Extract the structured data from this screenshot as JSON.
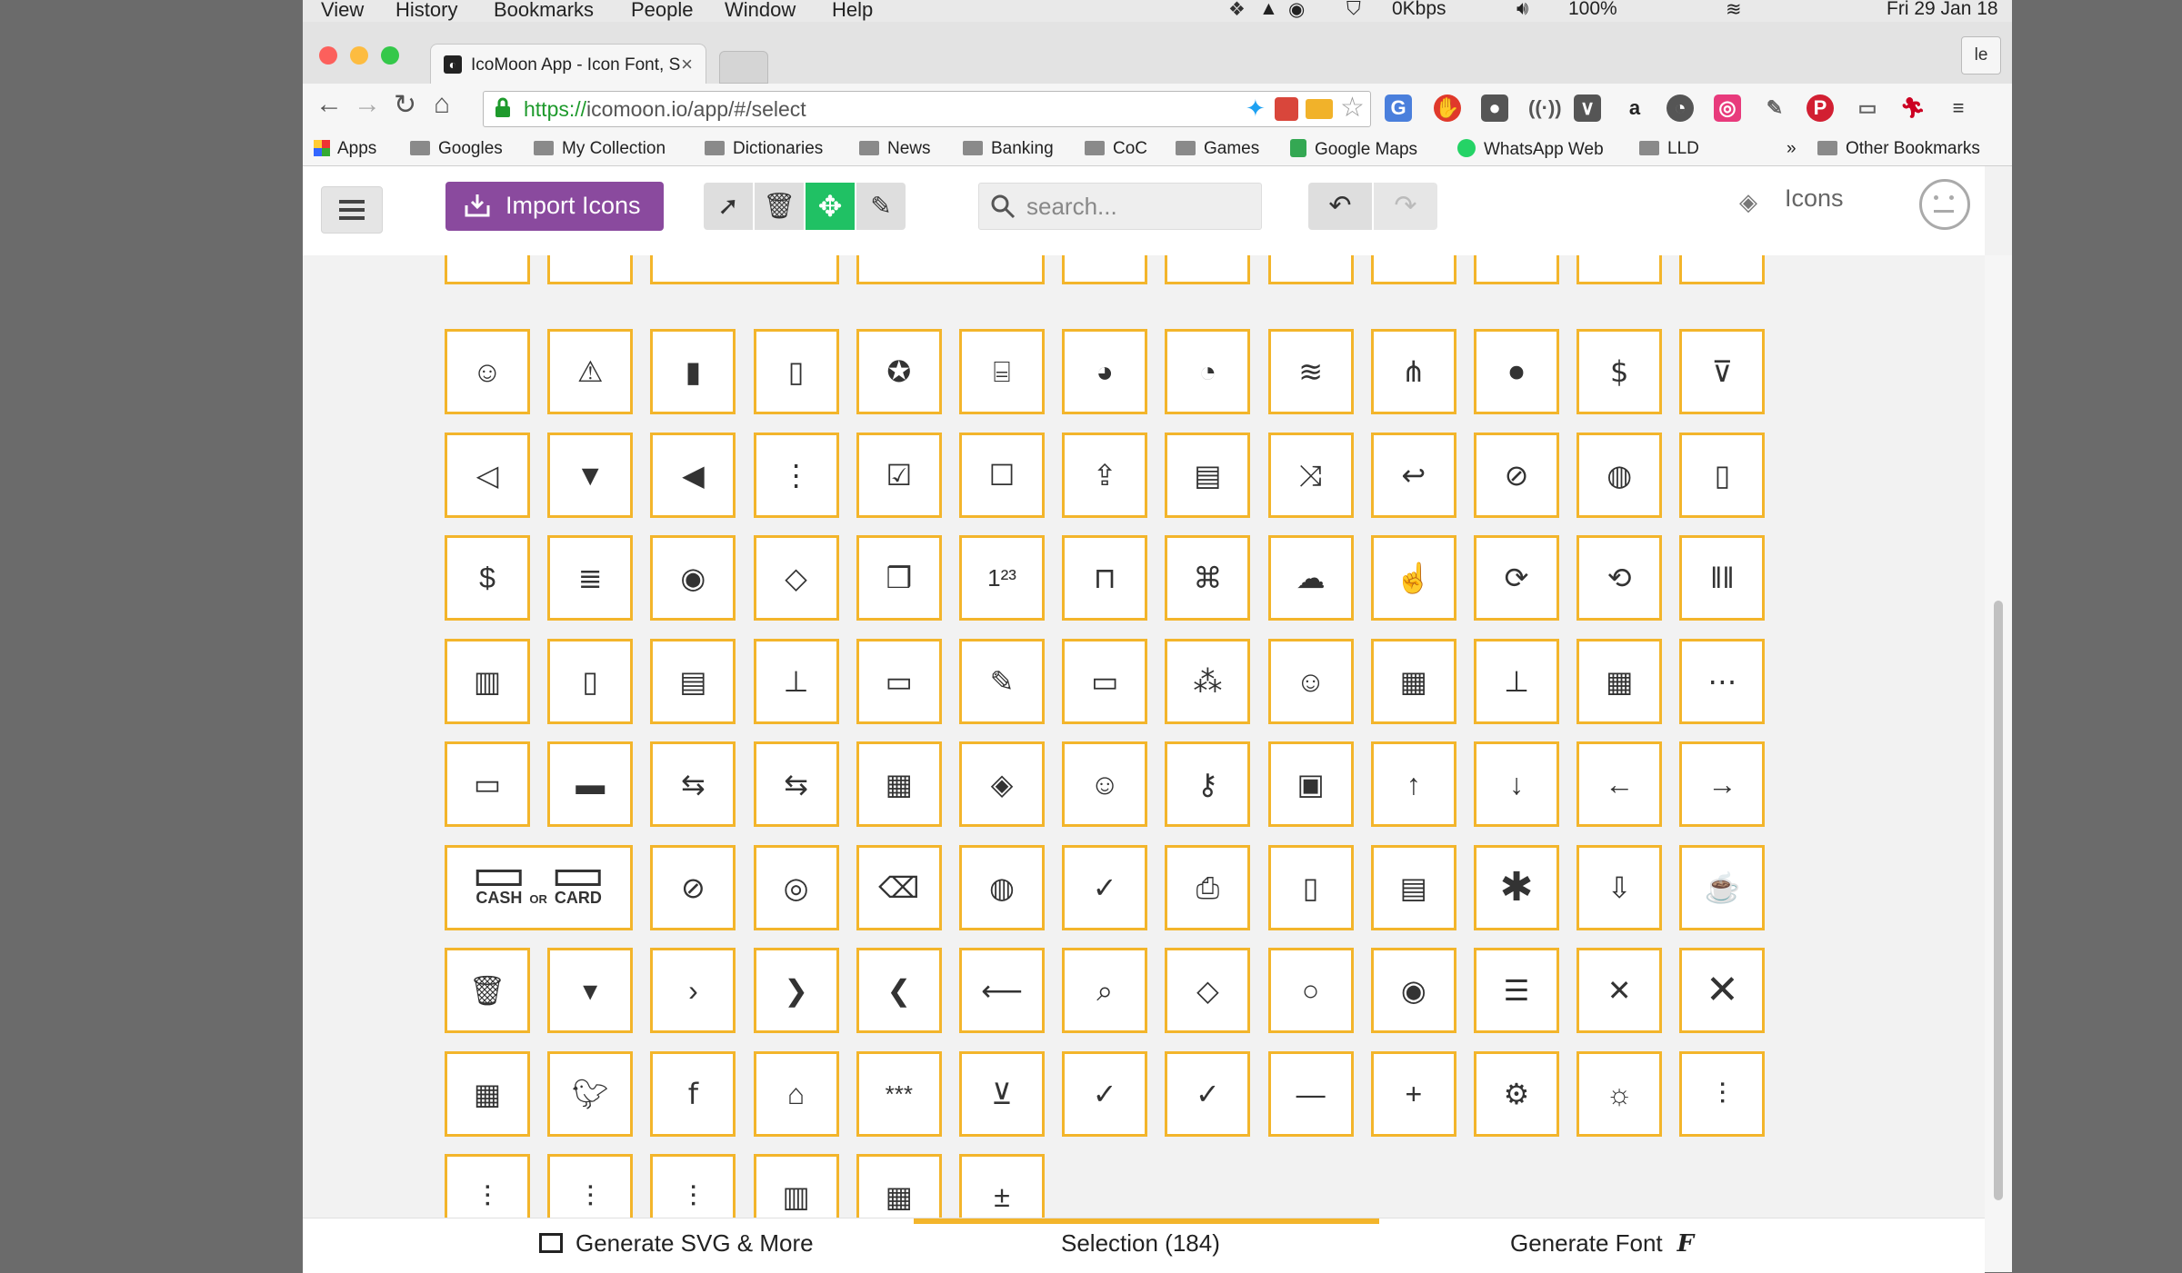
{
  "menubar": {
    "items": [
      "View",
      "History",
      "Bookmarks",
      "People",
      "Window",
      "Help"
    ],
    "status": {
      "net": "0Kbps",
      "battery": "100%",
      "datetime": "Fri 29 Jan  18"
    }
  },
  "browser": {
    "tab": {
      "title": "IcoMoon App - Icon Font, S",
      "close": "×"
    },
    "profile": "le",
    "address": {
      "scheme": "https://",
      "rest": "icomoon.io/app/#/select"
    },
    "bookmarks": [
      "Apps",
      "Googles",
      "My Collection",
      "Dictionaries",
      "News",
      "Banking",
      "CoC",
      "Games",
      "Google Maps",
      "WhatsApp Web",
      "LLD",
      "»",
      "Other Bookmarks"
    ]
  },
  "app": {
    "import_label": "Import Icons",
    "search_placeholder": "search...",
    "project_label": "Icons",
    "bottom": {
      "generate_svg": "Generate SVG & More",
      "selection": "Selection (184)",
      "generate_font": "Generate Font"
    }
  },
  "cash_or_card": {
    "cash": "CASH",
    "or": "OR",
    "card": "CARD"
  },
  "icon_rows": [
    [
      "user-badge-icon",
      "warning-icon",
      "small-cup-icon",
      "thermometer-icon",
      "award-ribbon-icon",
      "cash-register-icon",
      "coins-dollar-icon",
      "pie-clock-icon",
      "wifi-icon",
      "wifi-off-icon",
      "toggle-icon",
      "dollar-icon",
      "chevron-circle-down-icon"
    ],
    [
      "circle-left-icon",
      "circle-down-filled-icon",
      "circle-left-filled-icon",
      "dots-vertical-icon",
      "checkbox-checked-icon",
      "checkbox-empty-icon",
      "cart-upload-icon",
      "newspaper-icon",
      "shuffle-icon",
      "circle-back-icon",
      "barcode-banned-icon",
      "barcode-circle-icon",
      "mobile-dollar-icon"
    ],
    [
      "dollar-document-icon",
      "document-lines-icon",
      "coin-stack-icon",
      "tags-dollar-icon",
      "stack-pages-icon",
      "numbers-123-icon",
      "padlock-icon",
      "network-nodes-icon",
      "cloud-download-icon",
      "thumbs-up-icon",
      "sync-icon",
      "sync-rotate-icon",
      "barcode-icon"
    ],
    [
      "bar-chart-icon",
      "mobile-receipt-icon",
      "money-drawer-icon",
      "kiosk-icon",
      "pos-terminal-icon",
      "pen-signature-icon",
      "credit-cards-icon",
      "org-chart-icon",
      "cashier-icon",
      "calculator-icon",
      "register-stand-icon",
      "calendar-grid-icon",
      "dots-box-icon"
    ],
    [
      "banknote-icon",
      "credit-card-icon",
      "banknote-transfer-icon",
      "card-transfer-icon",
      "table-grid-icon",
      "tag-icon",
      "user-icon",
      "key-icon",
      "id-card-icon",
      "arrow-up-icon",
      "arrow-down-icon",
      "arrow-left-icon",
      "arrow-right-icon"
    ],
    [
      "cash-or-card-icon",
      "money-banned-icon",
      "user-circle-icon",
      "backspace-icon",
      "receipt-circle-icon",
      "check-circle-icon",
      "printer-icon",
      "smartphone-icon",
      "browser-window-icon",
      "asterisk-icon",
      "cart-download-icon",
      "coffee-cup-icon"
    ],
    [
      "trash-icon",
      "caret-down-icon",
      "chevron-right-small-icon",
      "chevron-right-icon",
      "chevron-left-icon",
      "arrow-left-long-icon",
      "search-icon",
      "tag-outline-icon",
      "circle-small-icon",
      "radio-dot-icon",
      "menu-lines-icon",
      "close-small-icon",
      "close-large-icon"
    ],
    [
      "grid-icon",
      "twitter-icon",
      "facebook-icon",
      "storefront-icon",
      "password-field-icon",
      "shopping-basket-icon",
      "check-small-icon",
      "check-icon",
      "minus-icon",
      "plus-icon",
      "gear-icon",
      "gear-sun-icon",
      "sliders-icon"
    ],
    [
      "sliders-three-icon",
      "sliders-four-icon",
      "sliders-five-icon",
      "bar-chart-small-icon",
      "dashboard-tiles-icon",
      "plus-minus-icon"
    ]
  ]
}
